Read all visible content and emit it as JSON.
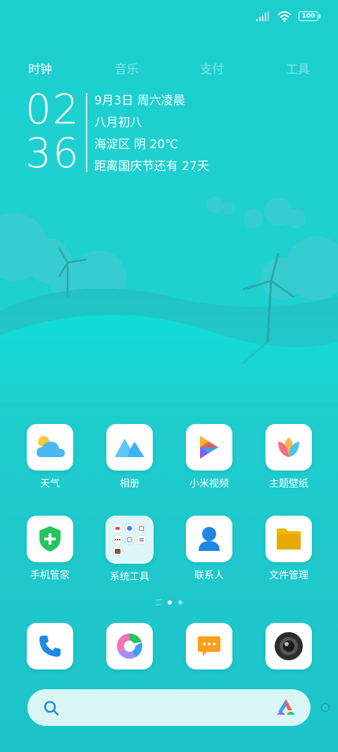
{
  "status": {
    "battery": "100"
  },
  "tabs": [
    {
      "label": "时钟"
    },
    {
      "label": "音乐"
    },
    {
      "label": "支付"
    },
    {
      "label": "工具"
    }
  ],
  "clock": {
    "hour": "02",
    "minute": "36",
    "date": "9月3日 周六凌晨",
    "lunar": "八月初八",
    "weather": "海淀区 阴 20℃",
    "countdown": "距离国庆节还有 27天"
  },
  "apps_row1": [
    {
      "label": "天气",
      "icon": "weather-icon"
    },
    {
      "label": "相册",
      "icon": "gallery-icon"
    },
    {
      "label": "小米视频",
      "icon": "video-icon"
    },
    {
      "label": "主题壁纸",
      "icon": "themes-icon"
    }
  ],
  "apps_row2": [
    {
      "label": "手机管家",
      "icon": "security-icon"
    },
    {
      "label": "系统工具",
      "icon": "folder-icon"
    },
    {
      "label": "联系人",
      "icon": "contacts-icon"
    },
    {
      "label": "文件管理",
      "icon": "file-manager-icon"
    }
  ],
  "dock": [
    {
      "icon": "phone-icon"
    },
    {
      "icon": "browser-icon"
    },
    {
      "icon": "messages-icon"
    },
    {
      "icon": "camera-icon"
    }
  ],
  "colors": {
    "background": "#1fd0d0",
    "search_bar": "#d9f6f6",
    "accent_blue": "#1e88e5"
  }
}
